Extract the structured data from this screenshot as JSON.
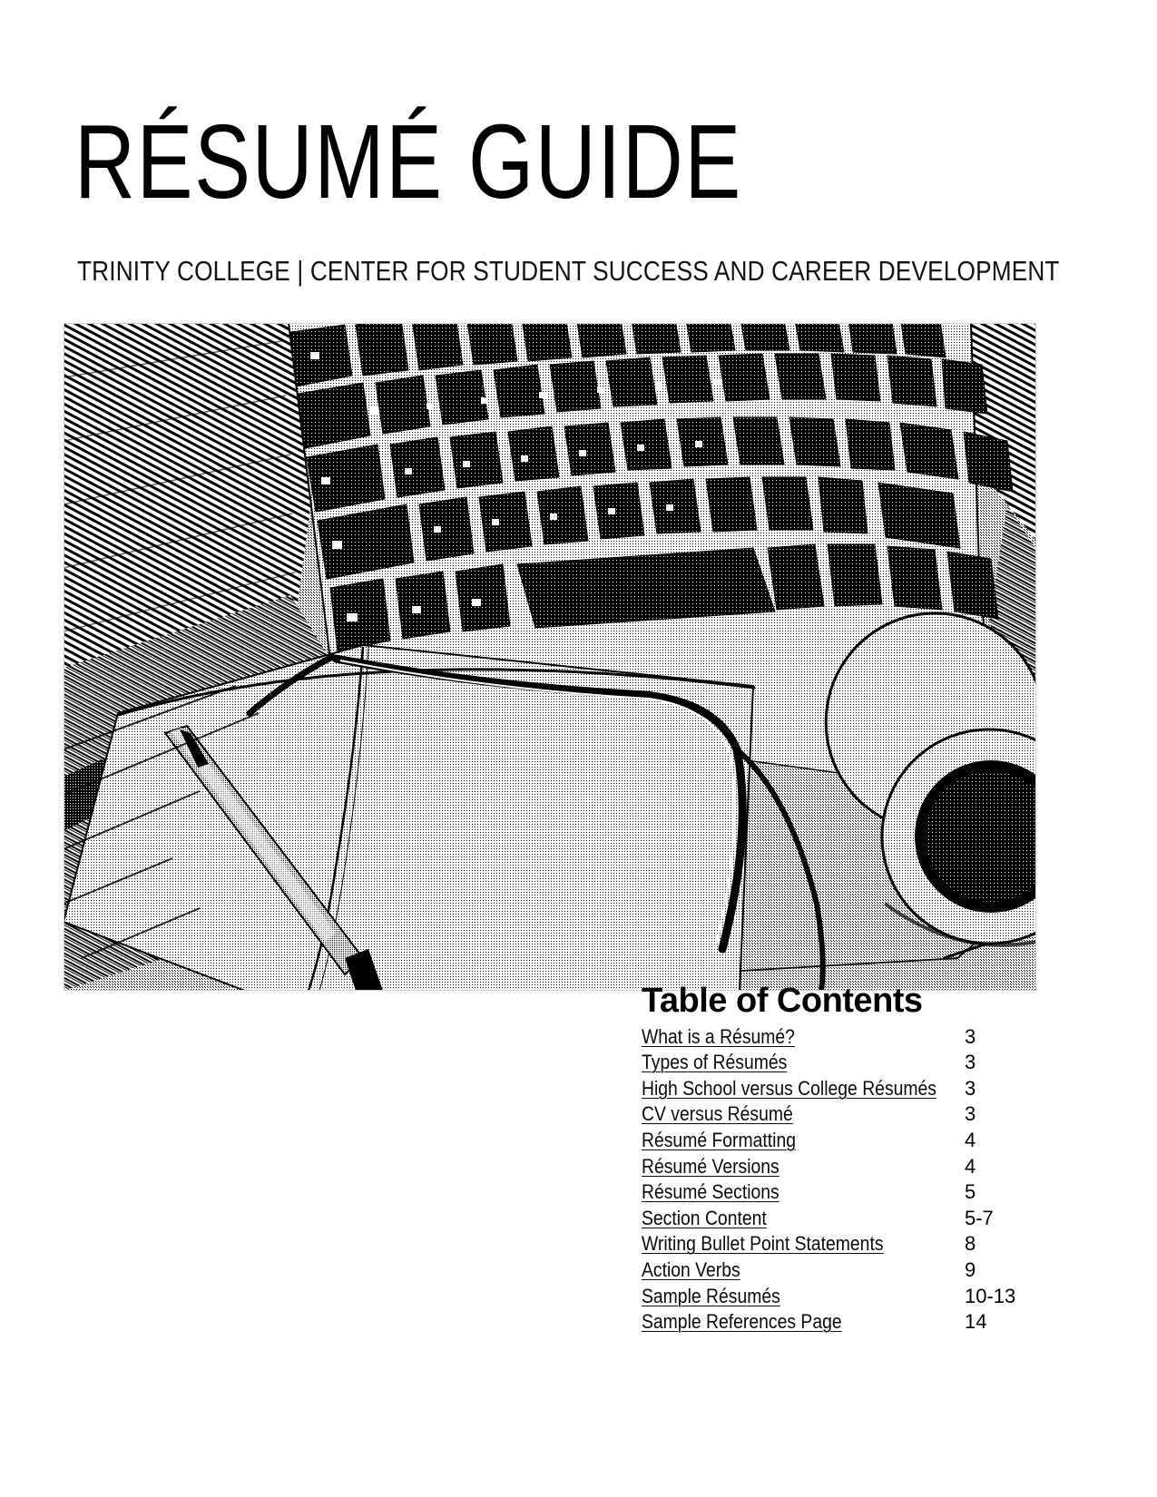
{
  "document": {
    "title": "RÉSUMÉ GUIDE",
    "subtitle": "TRINITY COLLEGE  |  CENTER FOR STUDENT SUCCESS AND CAREER DEVELOPMENT"
  },
  "hero_image": {
    "alt": "Black and white photo of an open laptop keyboard on a wooden desk with an open notebook, a pen, eyeglasses and a cup of coffee"
  },
  "toc": {
    "heading": "Table of Contents",
    "entries": [
      {
        "label": "What is a Résumé?",
        "page": "3"
      },
      {
        "label": "Types of Résumés",
        "page": "3"
      },
      {
        "label": "High School versus College Résumés",
        "page": "3"
      },
      {
        "label": "CV versus Résumé",
        "page": "3"
      },
      {
        "label": "Résumé Formatting",
        "page": "4"
      },
      {
        "label": "Résumé Versions",
        "page": "4"
      },
      {
        "label": "Résumé Sections",
        "page": "5"
      },
      {
        "label": "Section Content",
        "page": "5-7"
      },
      {
        "label": "Writing Bullet Point Statements",
        "page": "8"
      },
      {
        "label": "Action Verbs",
        "page": "9"
      },
      {
        "label": "Sample Résumés",
        "page": "10-13"
      },
      {
        "label": "Sample References Page",
        "page": "14"
      }
    ]
  }
}
